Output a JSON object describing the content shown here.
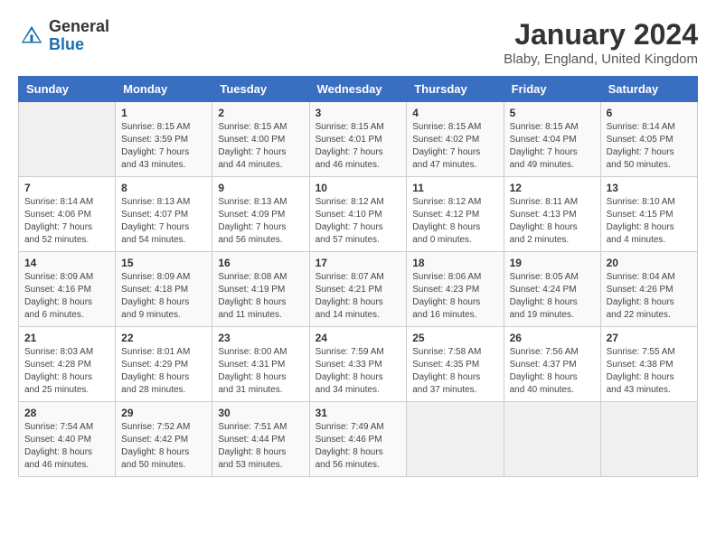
{
  "header": {
    "logo_general": "General",
    "logo_blue": "Blue",
    "month_title": "January 2024",
    "location": "Blaby, England, United Kingdom"
  },
  "weekdays": [
    "Sunday",
    "Monday",
    "Tuesday",
    "Wednesday",
    "Thursday",
    "Friday",
    "Saturday"
  ],
  "weeks": [
    [
      {
        "day": "",
        "content": ""
      },
      {
        "day": "1",
        "content": "Sunrise: 8:15 AM\nSunset: 3:59 PM\nDaylight: 7 hours\nand 43 minutes."
      },
      {
        "day": "2",
        "content": "Sunrise: 8:15 AM\nSunset: 4:00 PM\nDaylight: 7 hours\nand 44 minutes."
      },
      {
        "day": "3",
        "content": "Sunrise: 8:15 AM\nSunset: 4:01 PM\nDaylight: 7 hours\nand 46 minutes."
      },
      {
        "day": "4",
        "content": "Sunrise: 8:15 AM\nSunset: 4:02 PM\nDaylight: 7 hours\nand 47 minutes."
      },
      {
        "day": "5",
        "content": "Sunrise: 8:15 AM\nSunset: 4:04 PM\nDaylight: 7 hours\nand 49 minutes."
      },
      {
        "day": "6",
        "content": "Sunrise: 8:14 AM\nSunset: 4:05 PM\nDaylight: 7 hours\nand 50 minutes."
      }
    ],
    [
      {
        "day": "7",
        "content": "Sunrise: 8:14 AM\nSunset: 4:06 PM\nDaylight: 7 hours\nand 52 minutes."
      },
      {
        "day": "8",
        "content": "Sunrise: 8:13 AM\nSunset: 4:07 PM\nDaylight: 7 hours\nand 54 minutes."
      },
      {
        "day": "9",
        "content": "Sunrise: 8:13 AM\nSunset: 4:09 PM\nDaylight: 7 hours\nand 56 minutes."
      },
      {
        "day": "10",
        "content": "Sunrise: 8:12 AM\nSunset: 4:10 PM\nDaylight: 7 hours\nand 57 minutes."
      },
      {
        "day": "11",
        "content": "Sunrise: 8:12 AM\nSunset: 4:12 PM\nDaylight: 8 hours\nand 0 minutes."
      },
      {
        "day": "12",
        "content": "Sunrise: 8:11 AM\nSunset: 4:13 PM\nDaylight: 8 hours\nand 2 minutes."
      },
      {
        "day": "13",
        "content": "Sunrise: 8:10 AM\nSunset: 4:15 PM\nDaylight: 8 hours\nand 4 minutes."
      }
    ],
    [
      {
        "day": "14",
        "content": "Sunrise: 8:09 AM\nSunset: 4:16 PM\nDaylight: 8 hours\nand 6 minutes."
      },
      {
        "day": "15",
        "content": "Sunrise: 8:09 AM\nSunset: 4:18 PM\nDaylight: 8 hours\nand 9 minutes."
      },
      {
        "day": "16",
        "content": "Sunrise: 8:08 AM\nSunset: 4:19 PM\nDaylight: 8 hours\nand 11 minutes."
      },
      {
        "day": "17",
        "content": "Sunrise: 8:07 AM\nSunset: 4:21 PM\nDaylight: 8 hours\nand 14 minutes."
      },
      {
        "day": "18",
        "content": "Sunrise: 8:06 AM\nSunset: 4:23 PM\nDaylight: 8 hours\nand 16 minutes."
      },
      {
        "day": "19",
        "content": "Sunrise: 8:05 AM\nSunset: 4:24 PM\nDaylight: 8 hours\nand 19 minutes."
      },
      {
        "day": "20",
        "content": "Sunrise: 8:04 AM\nSunset: 4:26 PM\nDaylight: 8 hours\nand 22 minutes."
      }
    ],
    [
      {
        "day": "21",
        "content": "Sunrise: 8:03 AM\nSunset: 4:28 PM\nDaylight: 8 hours\nand 25 minutes."
      },
      {
        "day": "22",
        "content": "Sunrise: 8:01 AM\nSunset: 4:29 PM\nDaylight: 8 hours\nand 28 minutes."
      },
      {
        "day": "23",
        "content": "Sunrise: 8:00 AM\nSunset: 4:31 PM\nDaylight: 8 hours\nand 31 minutes."
      },
      {
        "day": "24",
        "content": "Sunrise: 7:59 AM\nSunset: 4:33 PM\nDaylight: 8 hours\nand 34 minutes."
      },
      {
        "day": "25",
        "content": "Sunrise: 7:58 AM\nSunset: 4:35 PM\nDaylight: 8 hours\nand 37 minutes."
      },
      {
        "day": "26",
        "content": "Sunrise: 7:56 AM\nSunset: 4:37 PM\nDaylight: 8 hours\nand 40 minutes."
      },
      {
        "day": "27",
        "content": "Sunrise: 7:55 AM\nSunset: 4:38 PM\nDaylight: 8 hours\nand 43 minutes."
      }
    ],
    [
      {
        "day": "28",
        "content": "Sunrise: 7:54 AM\nSunset: 4:40 PM\nDaylight: 8 hours\nand 46 minutes."
      },
      {
        "day": "29",
        "content": "Sunrise: 7:52 AM\nSunset: 4:42 PM\nDaylight: 8 hours\nand 50 minutes."
      },
      {
        "day": "30",
        "content": "Sunrise: 7:51 AM\nSunset: 4:44 PM\nDaylight: 8 hours\nand 53 minutes."
      },
      {
        "day": "31",
        "content": "Sunrise: 7:49 AM\nSunset: 4:46 PM\nDaylight: 8 hours\nand 56 minutes."
      },
      {
        "day": "",
        "content": ""
      },
      {
        "day": "",
        "content": ""
      },
      {
        "day": "",
        "content": ""
      }
    ]
  ]
}
